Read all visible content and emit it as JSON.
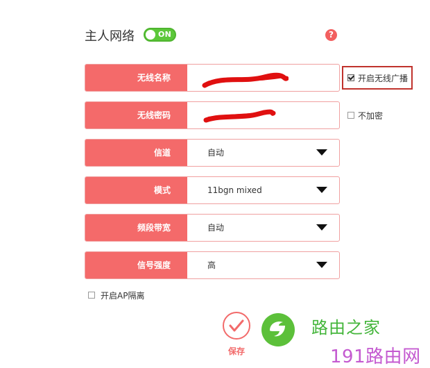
{
  "section": {
    "title": "主人网络",
    "toggle_label": "ON",
    "help": "?"
  },
  "fields": {
    "ssid": {
      "label": "无线名称"
    },
    "password": {
      "label": "无线密码"
    },
    "channel": {
      "label": "信道",
      "value": "自动"
    },
    "mode": {
      "label": "模式",
      "value": "11bgn mixed"
    },
    "bandwidth": {
      "label": "频段带宽",
      "value": "自动"
    },
    "signal": {
      "label": "信号强度",
      "value": "高"
    }
  },
  "options": {
    "broadcast": {
      "label": "开启无线广播",
      "checked": true
    },
    "no_encrypt": {
      "label": "不加密",
      "checked": false
    },
    "ap_isolation": {
      "label": "开启AP隔离",
      "checked": false
    }
  },
  "actions": {
    "save_label": "保存"
  },
  "watermark": {
    "line1": "路由之家",
    "line2": "191路由网"
  },
  "colors": {
    "accent": "#f46a6a",
    "toggle_on": "#5cc83a",
    "highlight": "#c0322c"
  }
}
